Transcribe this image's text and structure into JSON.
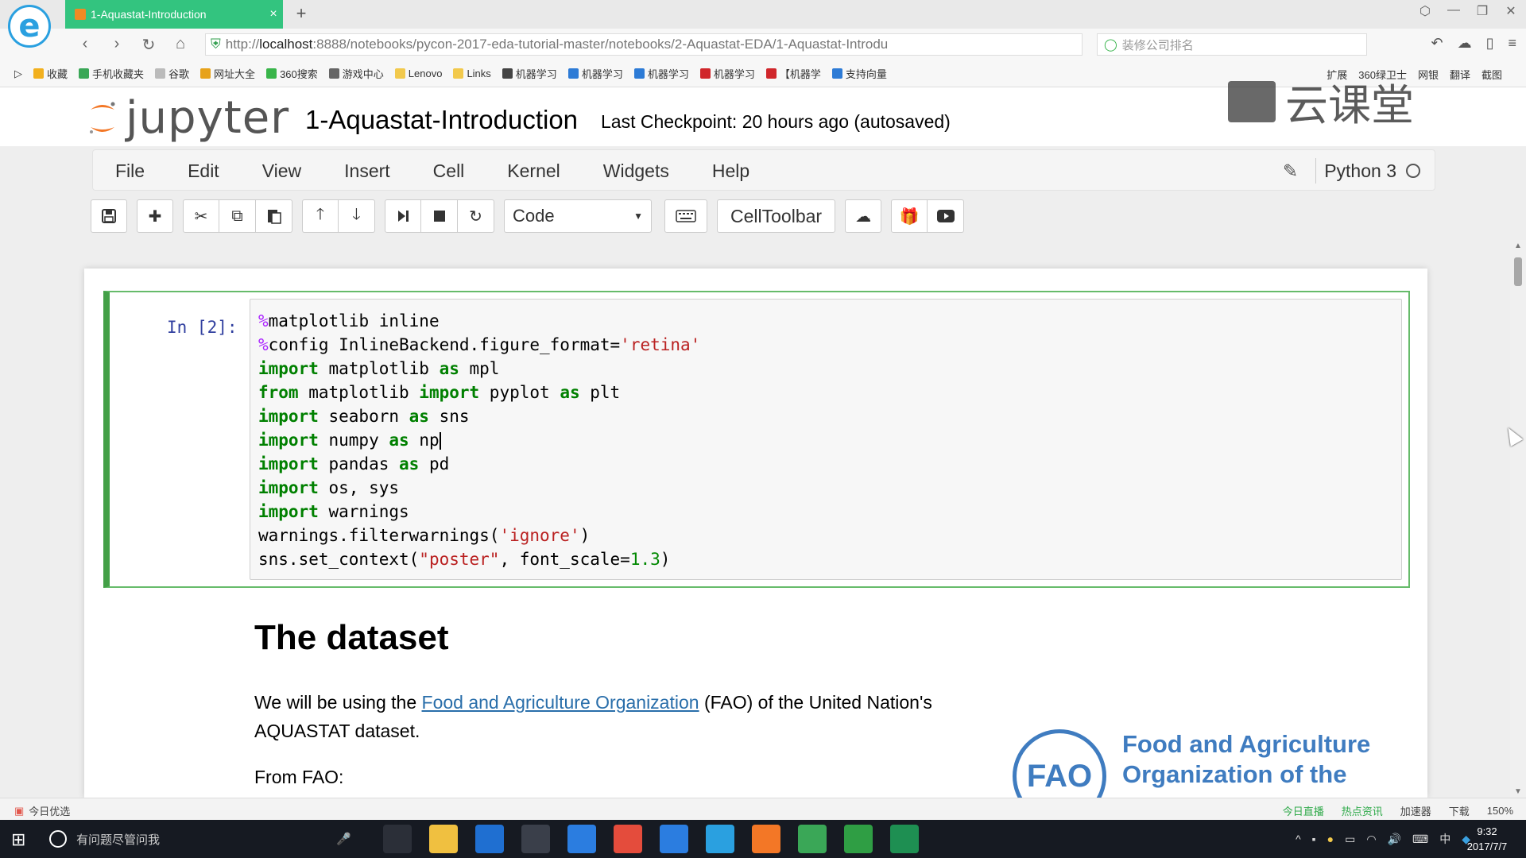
{
  "browser": {
    "tab_title": "1-Aquastat-Introduction",
    "tab_close": "×",
    "new_tab": "+",
    "url_scheme": "http://",
    "url_host": "localhost",
    "url_path": ":8888/notebooks/pycon-2017-eda-tutorial-master/notebooks/2-Aquastat-EDA/1-Aquastat-Introdu",
    "search_placeholder": "装修公司排名",
    "bookmarks": [
      {
        "label": "收藏",
        "color": "#f2b01e"
      },
      {
        "label": "手机收藏夹",
        "color": "#3aa757"
      },
      {
        "label": "谷歌",
        "color": "#bbbbbb"
      },
      {
        "label": "网址大全",
        "color": "#e7a21a"
      },
      {
        "label": "360搜索",
        "color": "#39b54a"
      },
      {
        "label": "游戏中心",
        "color": "#666666"
      },
      {
        "label": "Lenovo",
        "color": "#f2c94c"
      },
      {
        "label": "Links",
        "color": "#f2c94c"
      },
      {
        "label": "机器学习",
        "color": "#444444"
      },
      {
        "label": "机器学习",
        "color": "#2d7bd6"
      },
      {
        "label": "机器学习",
        "color": "#2d7bd6"
      },
      {
        "label": "机器学习",
        "color": "#d0262b"
      },
      {
        "label": "【机器学",
        "color": "#d0262b"
      },
      {
        "label": "支持向量",
        "color": "#2d7bd6"
      }
    ],
    "bookmarks_right": [
      "扩展",
      "360绿卫士",
      "网银",
      "翻译",
      "截图"
    ]
  },
  "jupyter": {
    "logo_text": "jupyter",
    "notebook_name": "1-Aquastat-Introduction",
    "checkpoint": "Last Checkpoint: 20 hours ago (autosaved)",
    "menu": [
      "File",
      "Edit",
      "View",
      "Insert",
      "Cell",
      "Kernel",
      "Widgets",
      "Help"
    ],
    "kernel_name": "Python 3",
    "cell_type": "Code",
    "celltoolbar": "CellToolbar"
  },
  "watermark": {
    "text": "云课堂"
  },
  "cell": {
    "prompt": "In [2]:"
  },
  "markdown": {
    "heading": "The dataset",
    "p1_before": "We will be using the ",
    "p1_link": "Food and Agriculture Organization",
    "p1_after": " (FAO) of the United Nation's AQUASTAT dataset.",
    "from": "From FAO:",
    "fao_line1": "Food and Agriculture",
    "fao_line2": "Organization of the",
    "fao_emblem": "FAO"
  },
  "statusbar": {
    "left": "今日优选",
    "right": [
      "今日直播",
      "热点资讯",
      "加速器",
      "下载",
      "150%"
    ]
  },
  "taskbar": {
    "search": "有问题尽管问我",
    "time": "9:32",
    "date": "2017/7/7",
    "ime": "中",
    "apps": [
      {
        "name": "task-view",
        "color": "#2b2f38"
      },
      {
        "name": "file-explorer",
        "color": "#f0c040"
      },
      {
        "name": "edge",
        "color": "#1f6fd1"
      },
      {
        "name": "store",
        "color": "#3a3f4a"
      },
      {
        "name": "app-blue",
        "color": "#2b7de0"
      },
      {
        "name": "chrome",
        "color": "#e44c3c"
      },
      {
        "name": "app-mail",
        "color": "#2b7de0"
      },
      {
        "name": "ie-browser",
        "color": "#2aa0e0"
      },
      {
        "name": "jupyter-app",
        "color": "#f37726"
      },
      {
        "name": "app-green",
        "color": "#3aa757"
      },
      {
        "name": "app-cam",
        "color": "#2f9e44"
      },
      {
        "name": "app-c",
        "color": "#1e8f52"
      }
    ]
  }
}
